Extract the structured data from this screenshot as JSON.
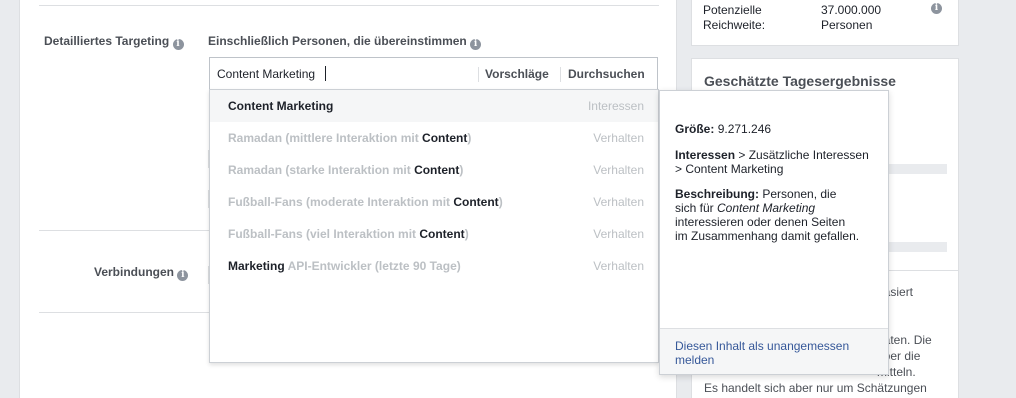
{
  "targeting": {
    "label": "Detailliertes Targeting",
    "include_label": "Einschließlich Personen, die übereinstimmen",
    "search_value": "Content Marketing",
    "tab_suggestions": "Vorschläge",
    "tab_browse": "Durchsuchen"
  },
  "connections": {
    "label": "Verbindungen"
  },
  "suggestions": [
    {
      "pre": "Content Marketing",
      "hl": "",
      "post": "",
      "type": "Interessen"
    },
    {
      "pre": "Ramadan (mittlere Interaktion mit ",
      "hl": "Content",
      "post": ")",
      "type": "Verhalten"
    },
    {
      "pre": "Ramadan (starke Interaktion mit ",
      "hl": "Content",
      "post": ")",
      "type": "Verhalten"
    },
    {
      "pre": "Fußball-Fans (moderate Interaktion mit ",
      "hl": "Content",
      "post": ")",
      "type": "Verhalten"
    },
    {
      "pre": "Fußball-Fans (viel Interaktion mit ",
      "hl": "Content",
      "post": ")",
      "type": "Verhalten"
    },
    {
      "hl_first": "Marketing",
      "pre": " API-Entwickler (letzte 90 Tage)",
      "type": "Verhalten"
    }
  ],
  "tooltip": {
    "size_label": "Größe:",
    "size_value": "9.271.246",
    "path_label": "Interessen",
    "path_rest": " > Zusätzliche Interessen > Content Marketing",
    "desc_label": "Beschreibung:",
    "desc_pre": " Personen, die sich für ",
    "desc_em": "Content Marketing",
    "desc_post": " interessieren oder denen Seiten im Zusammenhang damit gefallen.",
    "report_link": "Diesen Inhalt als unangemessen melden"
  },
  "reach": {
    "label_line1": "Potenzielle",
    "label_line2": "Reichweite:",
    "value": "37.000.000",
    "unit": "Personen"
  },
  "daily": {
    "heading": "Geschätzte Tagesergebnisse",
    "partial_1": "basiert",
    "partial_2": "daten. Die",
    "partial_3": "über die",
    "partial_4": "mitteln.",
    "partial_5": "Es handelt sich aber nur um Schätzungen"
  }
}
